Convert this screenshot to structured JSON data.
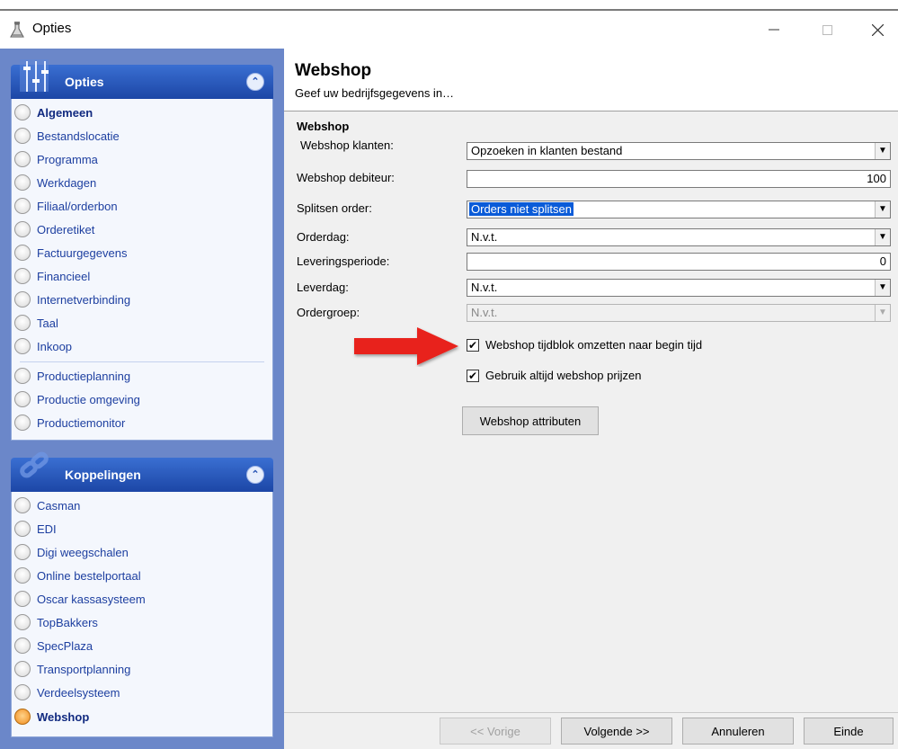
{
  "window": {
    "title": "Opties",
    "app_icon": "lab-flask-icon"
  },
  "sidebar": {
    "opties_panel": {
      "title": "Opties",
      "icon": "sliders-icon",
      "items": [
        {
          "label": "Algemeen",
          "bold": true
        },
        {
          "label": "Bestandslocatie"
        },
        {
          "label": "Programma"
        },
        {
          "label": "Werkdagen"
        },
        {
          "label": "Filiaal/orderbon"
        },
        {
          "label": "Orderetiket"
        },
        {
          "label": "Factuurgegevens"
        },
        {
          "label": "Financieel"
        },
        {
          "label": "Internetverbinding"
        },
        {
          "label": "Taal"
        },
        {
          "label": "Inkoop"
        },
        {
          "label": "Productieplanning"
        },
        {
          "label": "Productie omgeving"
        },
        {
          "label": "Productiemonitor"
        }
      ]
    },
    "koppelingen_panel": {
      "title": "Koppelingen",
      "icon": "link-chain-icon",
      "items": [
        {
          "label": "Casman"
        },
        {
          "label": "EDI"
        },
        {
          "label": "Digi weegschalen"
        },
        {
          "label": "Online bestelportaal"
        },
        {
          "label": "Oscar kassasysteem"
        },
        {
          "label": "TopBakkers"
        },
        {
          "label": "SpecPlaza"
        },
        {
          "label": "Transportplanning"
        },
        {
          "label": "Verdeelsysteem"
        },
        {
          "label": "Webshop",
          "bold": true,
          "active": true
        }
      ]
    }
  },
  "header": {
    "title": "Webshop",
    "subtitle": "Geef uw bedrijfsgegevens in…"
  },
  "form": {
    "section_title": "Webshop",
    "fields": {
      "webshop_klanten": {
        "label": "Webshop klanten:",
        "value": "Opzoeken in klanten bestand"
      },
      "webshop_debiteur": {
        "label": "Webshop debiteur:",
        "value": "100"
      },
      "splitsen_order": {
        "label": "Splitsen order:",
        "value": "Orders niet splitsen"
      },
      "orderdag": {
        "label": "Orderdag:",
        "value": "N.v.t."
      },
      "leveringsperiode": {
        "label": "Leveringsperiode:",
        "value": "0"
      },
      "leverdag": {
        "label": "Leverdag:",
        "value": "N.v.t."
      },
      "ordergroep": {
        "label": "Ordergroep:",
        "value": "N.v.t."
      }
    },
    "checkboxes": {
      "tijdblok": {
        "label": "Webshop tijdblok omzetten naar begin tijd",
        "checked": true
      },
      "prijzen": {
        "label": "Gebruik altijd webshop prijzen",
        "checked": true
      }
    },
    "attributes_button": "Webshop attributen"
  },
  "footer": {
    "prev": "<< Vorige",
    "next": "Volgende >>",
    "cancel": "Annuleren",
    "end": "Einde"
  },
  "colors": {
    "accent": "#1c46a6",
    "arrow": "#e8201a",
    "selection": "#0a5bd8"
  }
}
